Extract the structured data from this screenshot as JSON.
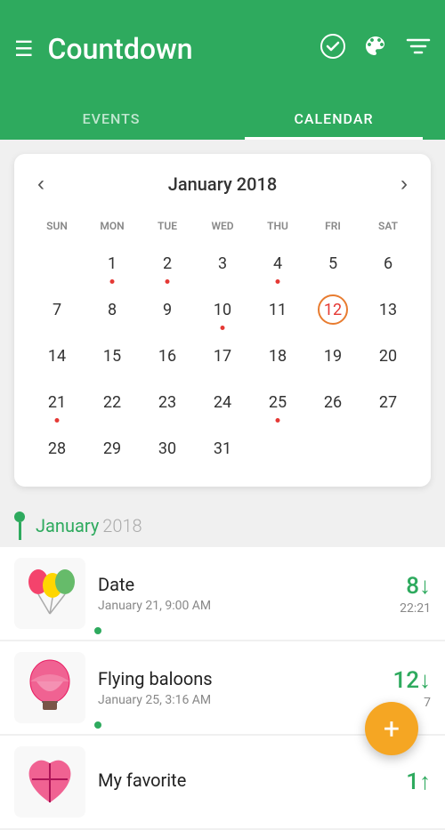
{
  "header": {
    "menu_icon": "☰",
    "title": "Countdown",
    "check_icon": "✔",
    "palette_icon": "🎨",
    "filter_icon": "☰"
  },
  "tabs": [
    {
      "label": "EVENTS",
      "active": false
    },
    {
      "label": "CALENDAR",
      "active": true
    }
  ],
  "calendar": {
    "title": "January 2018",
    "prev_icon": "‹",
    "next_icon": "›",
    "weekdays": [
      "SUN",
      "MON",
      "TUE",
      "WED",
      "THU",
      "FRI",
      "SAT"
    ],
    "weeks": [
      [
        null,
        1,
        2,
        3,
        4,
        5,
        6
      ],
      [
        7,
        8,
        9,
        10,
        11,
        12,
        13
      ],
      [
        14,
        15,
        16,
        17,
        18,
        19,
        20
      ],
      [
        21,
        22,
        23,
        24,
        25,
        26,
        27
      ],
      [
        28,
        29,
        30,
        31,
        null,
        null,
        null
      ]
    ],
    "dots": [
      1,
      2,
      4,
      10,
      21,
      25
    ],
    "today": 12
  },
  "section": {
    "month": "January",
    "year": "2018"
  },
  "events": [
    {
      "id": "date-event",
      "name": "Date",
      "date": "January 21, 9:00 AM",
      "days": "8",
      "arrow": "↓",
      "time": "22:21",
      "icon": "🎈",
      "dot": true
    },
    {
      "id": "flying-balloons-event",
      "name": "Flying baloons",
      "date": "January 25, 3:16 AM",
      "days": "12",
      "arrow": "↓",
      "time": "7",
      "icon": "🎈",
      "dot": true
    },
    {
      "id": "my-favorite-event",
      "name": "My favorite",
      "date": "",
      "days": "1",
      "arrow": "↑",
      "time": "",
      "icon": "💝",
      "dot": false
    }
  ],
  "fab": {
    "icon": "+",
    "label": "Add event"
  }
}
